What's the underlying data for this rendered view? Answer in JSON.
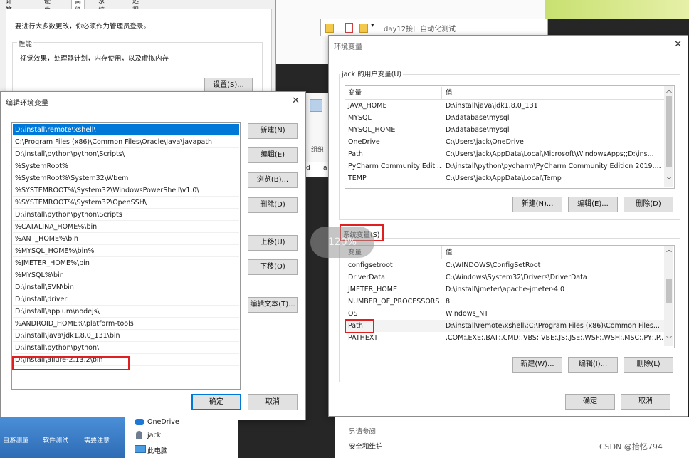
{
  "sysprops": {
    "tabs": [
      "计算机名",
      "硬件",
      "高级",
      "系统保护",
      "远程"
    ],
    "admin_note": "要进行大多数更改，你必须作为管理员登录。",
    "perf_group": "性能",
    "perf_desc": "视觉效果，处理器计划，内存使用，以及虚拟内存",
    "settings_btn": "设置(S)..."
  },
  "explorer": {
    "breadcrumb": "day12接口自动化测试",
    "ribbon_group": "组织",
    "path_frag_d": "d",
    "path_frag_a": "a"
  },
  "edit_dialog": {
    "title": "编辑环境变量",
    "items": [
      "D:\\install\\remote\\xshell\\",
      "C:\\Program Files (x86)\\Common Files\\Oracle\\Java\\javapath",
      "D:\\install\\python\\python\\Scripts\\",
      "%SystemRoot%",
      "%SystemRoot%\\System32\\Wbem",
      "%SYSTEMROOT%\\System32\\WindowsPowerShell\\v1.0\\",
      "%SYSTEMROOT%\\System32\\OpenSSH\\",
      "D:\\install\\python\\python\\Scripts",
      "%CATALINA_HOME%\\bin",
      "%ANT_HOME%\\bin",
      "%MYSQL_HOME%\\bin%",
      "%JMETER_HOME%\\bin",
      "%MYSQL%\\bin",
      "D:\\install\\SVN\\bin",
      "D:\\install\\driver",
      "D:\\install\\appium\\nodejs\\",
      "%ANDROID_HOME%\\platform-tools",
      "D:\\install\\java\\jdk1.8.0_131\\bin",
      "D:\\install\\python\\python\\",
      "D:\\install\\allure-2.13.2\\bin"
    ],
    "buttons": {
      "new": "新建(N)",
      "edit": "编辑(E)",
      "browse": "浏览(B)...",
      "delete": "删除(D)",
      "up": "上移(U)",
      "down": "下移(O)",
      "edit_text": "编辑文本(T)...",
      "ok": "确定",
      "cancel": "取消"
    }
  },
  "env_dialog": {
    "title": "环境变量",
    "user_group": "jack 的用户变量(U)",
    "col_var": "变量",
    "col_val": "值",
    "user_vars": [
      {
        "name": "JAVA_HOME",
        "value": "D:\\install\\java\\jdk1.8.0_131"
      },
      {
        "name": "MYSQL",
        "value": "D:\\database\\mysql"
      },
      {
        "name": "MYSQL_HOME",
        "value": "D:\\database\\mysql"
      },
      {
        "name": "OneDrive",
        "value": "C:\\Users\\jack\\OneDrive"
      },
      {
        "name": "Path",
        "value": "C:\\Users\\jack\\AppData\\Local\\Microsoft\\WindowsApps;;D:\\ins..."
      },
      {
        "name": "PyCharm Community Editi...",
        "value": "D:\\install\\python\\pycharm\\PyCharm Community Edition 2019...."
      },
      {
        "name": "TEMP",
        "value": "C:\\Users\\jack\\AppData\\Local\\Temp"
      }
    ],
    "user_buttons": {
      "new": "新建(N)...",
      "edit": "编辑(E)...",
      "delete": "删除(D)"
    },
    "sys_group": "系统变量(S)",
    "sys_vars": [
      {
        "name": "configsetroot",
        "value": "C:\\WINDOWS\\ConfigSetRoot"
      },
      {
        "name": "DriverData",
        "value": "C:\\Windows\\System32\\Drivers\\DriverData"
      },
      {
        "name": "JMETER_HOME",
        "value": "D:\\install\\jmeter\\apache-jmeter-4.0"
      },
      {
        "name": "NUMBER_OF_PROCESSORS",
        "value": "8"
      },
      {
        "name": "OS",
        "value": "Windows_NT"
      },
      {
        "name": "Path",
        "value": "D:\\install\\remote\\xshell\\;C:\\Program Files (x86)\\Common Files..."
      },
      {
        "name": "PATHEXT",
        "value": ".COM;.EXE;.BAT;.CMD;.VBS;.VBE;.JS;.JSE;.WSF;.WSH;.MSC;.PY;.P..."
      }
    ],
    "sys_buttons": {
      "new": "新建(W)...",
      "edit": "编辑(I)...",
      "delete": "删除(L)"
    },
    "ok": "确定",
    "cancel": "取消"
  },
  "zoom_overlay": "120%",
  "sidebar_nav": {
    "onedrive": "OneDrive",
    "jack": "jack",
    "this_pc": "此电脑"
  },
  "bottom_links": {
    "see_also": "另请参阅",
    "security": "安全和维护"
  },
  "desktop_labels": [
    "自游测量",
    "软件测试",
    "需要注意"
  ],
  "watermark": "CSDN @拾忆794"
}
